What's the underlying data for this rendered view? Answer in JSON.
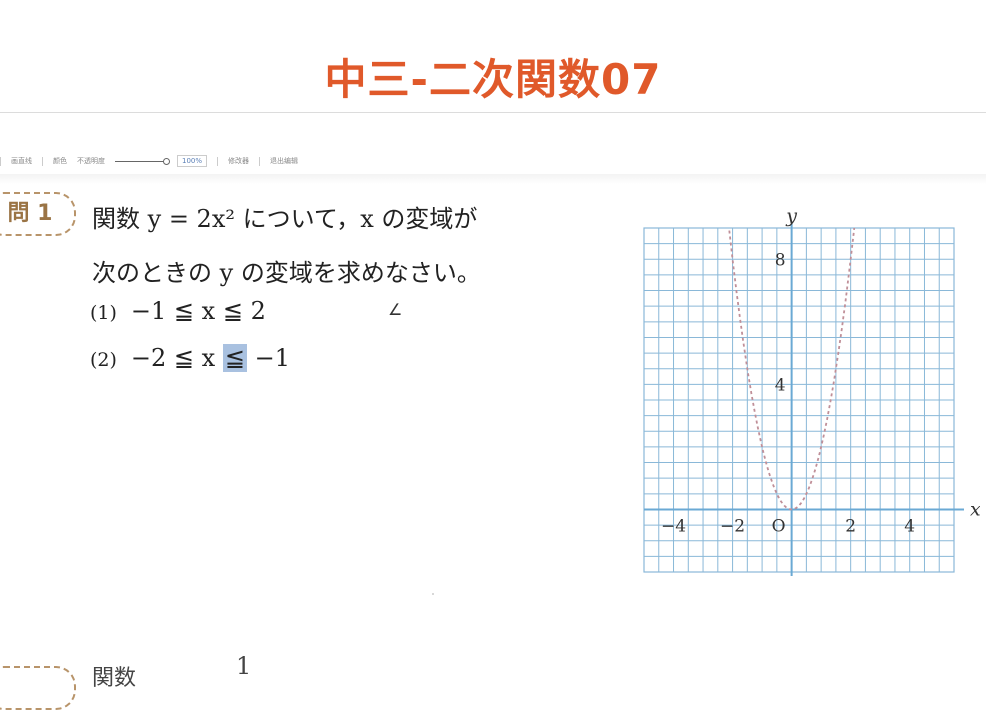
{
  "title": "中三-二次関数07",
  "toolbar": {
    "items": [
      "画直线",
      "颜色",
      "不透明度",
      "100%",
      "修改器",
      "退出编辑"
    ]
  },
  "question1": {
    "badge": "問 1",
    "line1": "関数 y = 2x² について，x の変域が",
    "line2": "次のときの y の変域を求めなさい。",
    "items": [
      {
        "index": "(1)",
        "text": "−1 ≦ x ≦ 2"
      },
      {
        "index": "(2)",
        "text_before": "−2 ≦ x ",
        "highlighted": "≦",
        "text_after": " −1"
      }
    ],
    "annotation": "∠"
  },
  "chart_data": {
    "type": "line",
    "function": "y = 2x^2",
    "xlabel": "x",
    "ylabel": "y",
    "origin_label": "O",
    "xlim": [
      -5,
      5.5
    ],
    "ylim": [
      -2,
      9
    ],
    "x_ticks": [
      -4,
      -2,
      2,
      4
    ],
    "x_tick_labels": [
      "−4",
      "−2",
      "2",
      "4"
    ],
    "y_ticks": [
      4,
      8
    ],
    "y_tick_labels": [
      "4",
      "8"
    ],
    "grid": true,
    "series": [
      {
        "x": [
          -2.2,
          -2,
          -1.5,
          -1,
          -0.5,
          0,
          0.5,
          1,
          1.5,
          2,
          2.2
        ],
        "values": [
          9.68,
          8,
          4.5,
          2,
          0.5,
          0,
          0.5,
          2,
          4.5,
          8,
          9.68
        ]
      }
    ],
    "colors": {
      "grid": "#8ab8d8",
      "axis": "#6aa9d4",
      "curve": "#c08f98"
    }
  },
  "question2": {
    "stub": "関数",
    "frac_top": "1"
  }
}
